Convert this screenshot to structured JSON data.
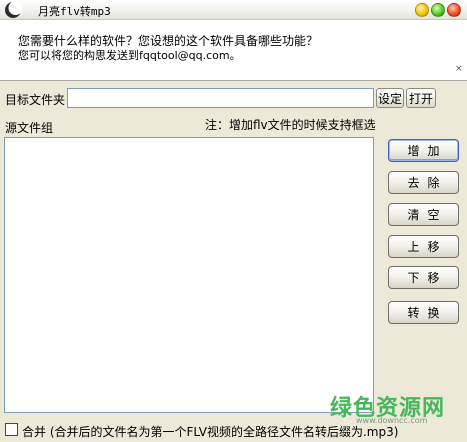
{
  "window": {
    "title": "月亮flv转mp3",
    "icon": "moon-app-icon"
  },
  "info": {
    "line1": "您需要什么样的软件？您设想的这个软件具备哪些功能？",
    "line2": "您可以将您的构思发送到fqqtool@qq.com。",
    "close_glyph": "×"
  },
  "target": {
    "label": "目标文件夹",
    "value": "",
    "set_label": "设定",
    "open_label": "打开"
  },
  "source": {
    "label": "源文件组",
    "note": "注：增加flv文件的时候支持框选",
    "items": []
  },
  "actions": {
    "add": "增加",
    "remove": "去除",
    "clear": "清空",
    "up": "上移",
    "down": "下移",
    "convert": "转换"
  },
  "merge": {
    "checked": false,
    "label": "合并 (合并后的文件名为第一个FLV视频的全路径文件名转后缀为.mp3)"
  },
  "watermark": {
    "main": "绿色资源网",
    "url": "www.downcc.com"
  }
}
